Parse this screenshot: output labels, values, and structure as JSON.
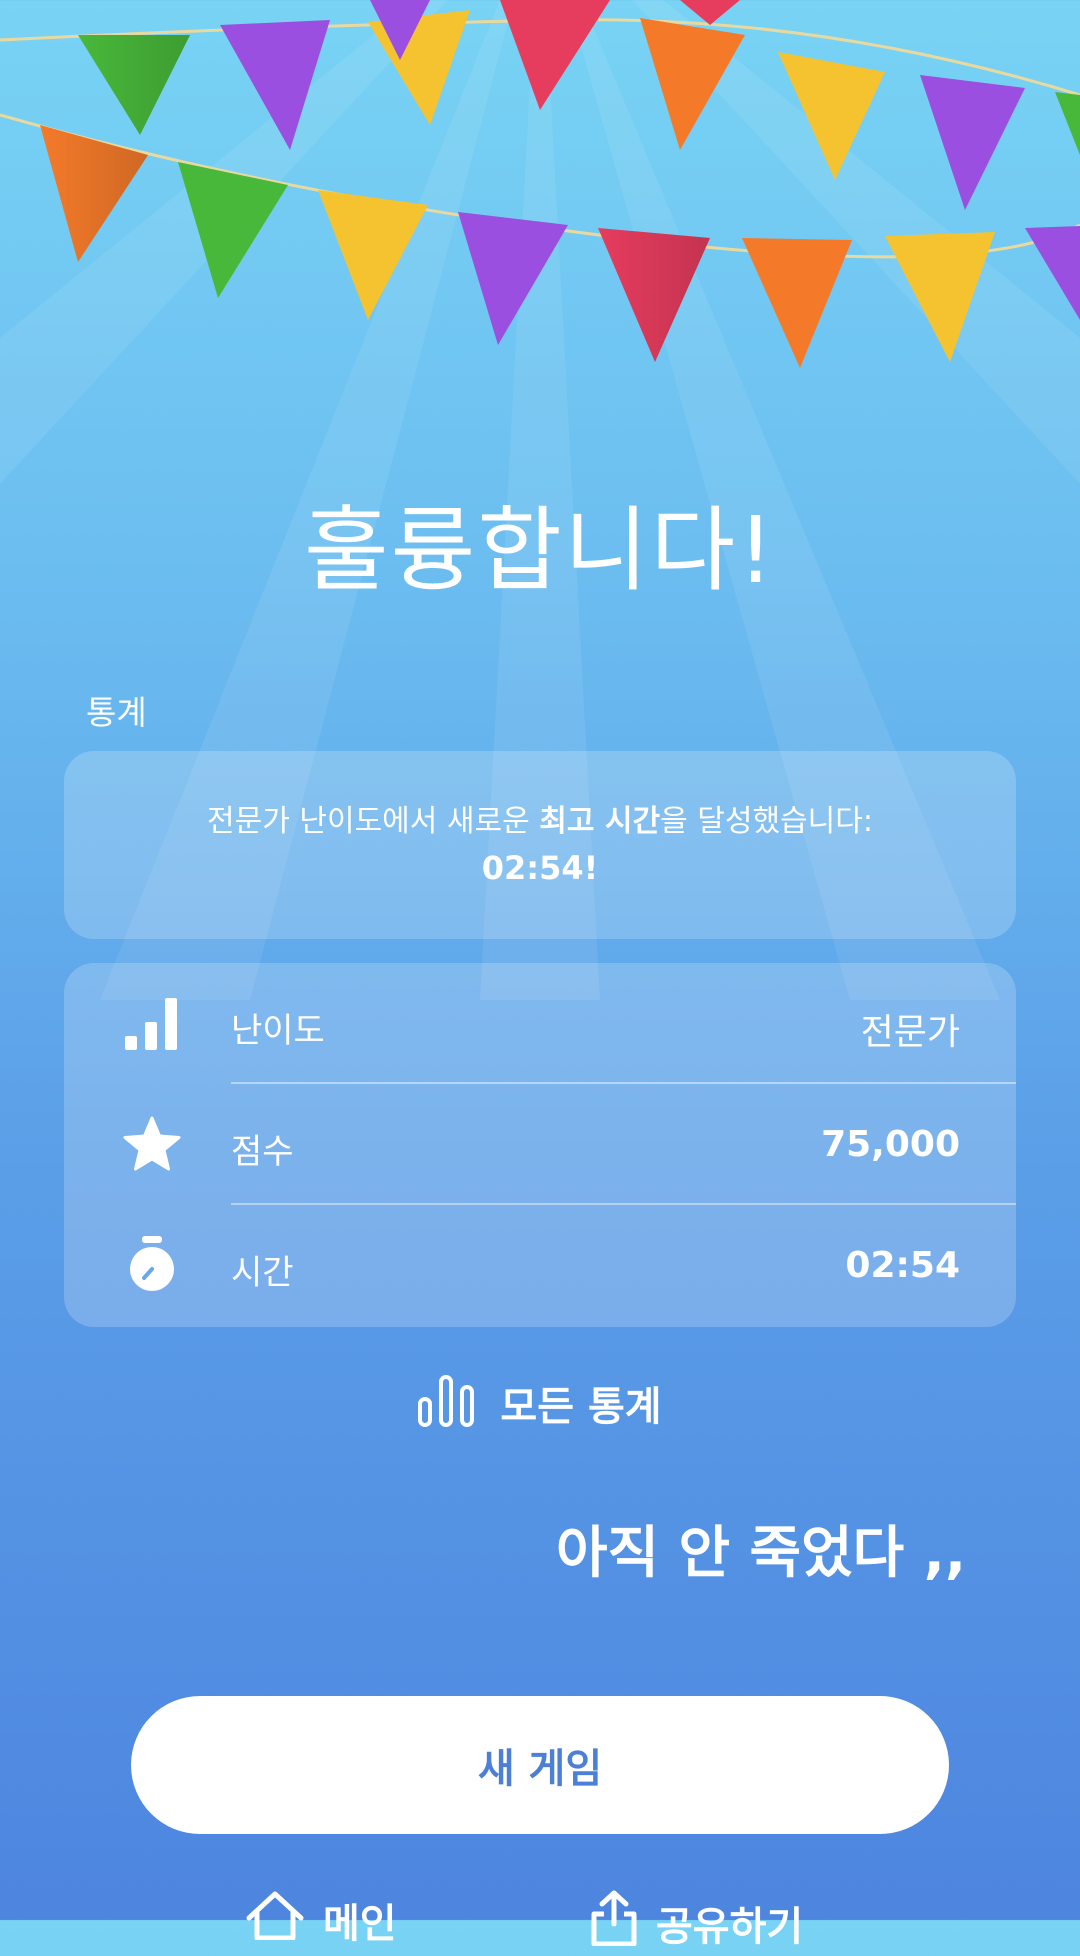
{
  "header": {
    "title": "훌륭합니다!"
  },
  "stats_section": {
    "label": "통계"
  },
  "record": {
    "prefix": "전문가 난이도에서 새로운 ",
    "highlight": "최고 시간",
    "suffix": "을 달성했습니다:",
    "time": "02:54!"
  },
  "stats": [
    {
      "icon": "signal-bars-icon",
      "label": "난이도",
      "value": "전문가"
    },
    {
      "icon": "star-icon",
      "label": "점수",
      "value": "75,000"
    },
    {
      "icon": "stopwatch-icon",
      "label": "시간",
      "value": "02:54"
    }
  ],
  "all_stats": {
    "label": "모든 통계",
    "icon": "bar-chart-icon"
  },
  "overlay_text": "아직 안 죽었다 ,,",
  "new_game": {
    "label": "새 게임"
  },
  "bottom": {
    "main_label": "메인",
    "share_label": "공유하기"
  },
  "colors": {
    "button_text": "#4c7fd6",
    "bunting": [
      "#f47a2a",
      "#48b83a",
      "#9a4fe0",
      "#f6c330",
      "#e63c5e"
    ]
  }
}
